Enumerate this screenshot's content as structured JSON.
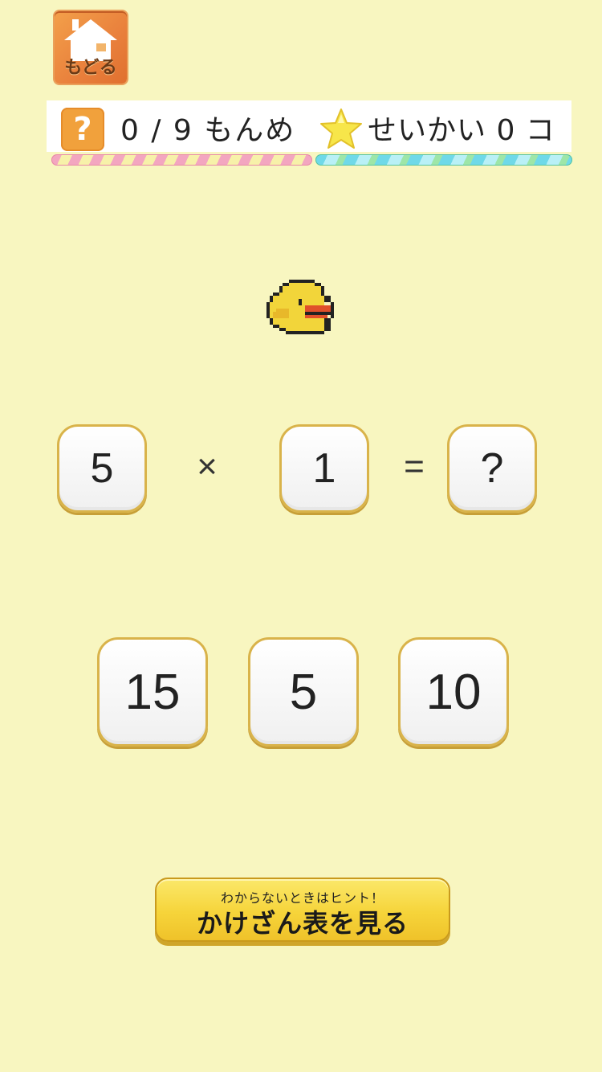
{
  "home": {
    "label": "もどる",
    "icon": "house-icon"
  },
  "status": {
    "question_icon": "question-mark-icon",
    "question_symbol": "?",
    "progress": "0 / 9 もんめ",
    "star_icon": "star-icon",
    "score": "せいかい 0 コ"
  },
  "mascot": {
    "icon": "chick-icon"
  },
  "equation": {
    "left": "5",
    "operator": "×",
    "right": "1",
    "equals": "=",
    "answer": "?"
  },
  "choices": [
    "15",
    "5",
    "10"
  ],
  "hint": {
    "subtitle": "わからないときはヒント！",
    "label": "かけざん表を見る"
  },
  "colors": {
    "background": "#f8f6c0",
    "home_button": "#e9803c",
    "question_icon": "#f1a13c",
    "star": "#f7e64a",
    "hint_button": "#f6d43a",
    "tile_border": "#d9b34a"
  }
}
